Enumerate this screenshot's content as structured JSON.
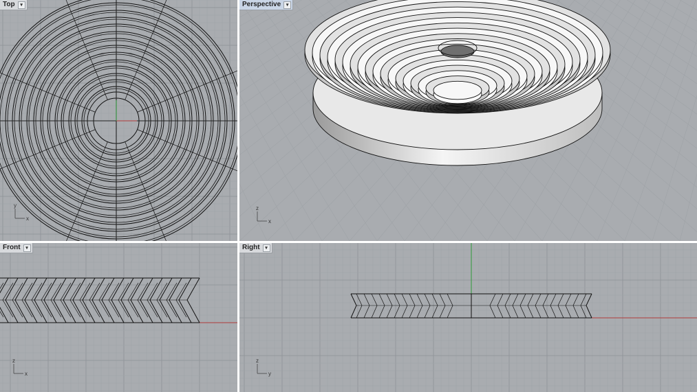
{
  "viewports": {
    "top": {
      "label": "Top",
      "active": false
    },
    "persp": {
      "label": "Perspective",
      "active": true
    },
    "front": {
      "label": "Front",
      "active": false
    },
    "right": {
      "label": "Right",
      "active": false
    }
  },
  "axes": {
    "x": "x",
    "y": "y",
    "z": "z"
  },
  "dropdown_glyph": "▾",
  "colors": {
    "viewport_bg": "#a9acb0",
    "grid_minor": "#9fa3a7",
    "grid_major": "#8e9296",
    "curve": "#111111",
    "x_axis": "#b03a3a",
    "y_axis": "#2f9a3a",
    "surface_light": "#f0f0f0",
    "surface_dark": "#6f6f6f"
  }
}
